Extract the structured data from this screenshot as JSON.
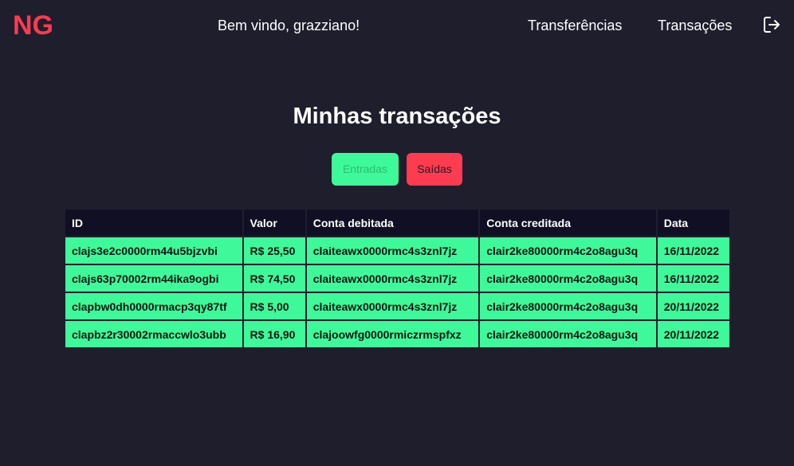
{
  "header": {
    "logo": "NG",
    "welcome": "Bem vindo, grazziano!",
    "nav": {
      "transfers": "Transferências",
      "transactions": "Transações"
    },
    "logout_icon": "logout-icon"
  },
  "main": {
    "title": "Minhas transações",
    "filters": {
      "in": "Entradas",
      "out": "Saídas"
    },
    "colors": {
      "accent_green": "#3ef99a",
      "accent_red": "#ff3b4f",
      "background": "#1f1e2d",
      "table_header": "#100f24"
    },
    "table": {
      "headers": [
        "ID",
        "Valor",
        "Conta debitada",
        "Conta creditada",
        "Data"
      ],
      "rows": [
        [
          "clajs3e2c0000rm44u5bjzvbi",
          "R$ 25,50",
          "claiteawx0000rmc4s3znl7jz",
          "clair2ke80000rm4c2o8agu3q",
          "16/11/2022"
        ],
        [
          "clajs63p70002rm44ika9ogbi",
          "R$ 74,50",
          "claiteawx0000rmc4s3znl7jz",
          "clair2ke80000rm4c2o8agu3q",
          "16/11/2022"
        ],
        [
          "clapbw0dh0000rmacp3qy87tf",
          "R$ 5,00",
          "claiteawx0000rmc4s3znl7jz",
          "clair2ke80000rm4c2o8agu3q",
          "20/11/2022"
        ],
        [
          "clapbz2r30002rmaccwlo3ubb",
          "R$ 16,90",
          "clajoowfg0000rmiczrmspfxz",
          "clair2ke80000rm4c2o8agu3q",
          "20/11/2022"
        ]
      ]
    }
  }
}
